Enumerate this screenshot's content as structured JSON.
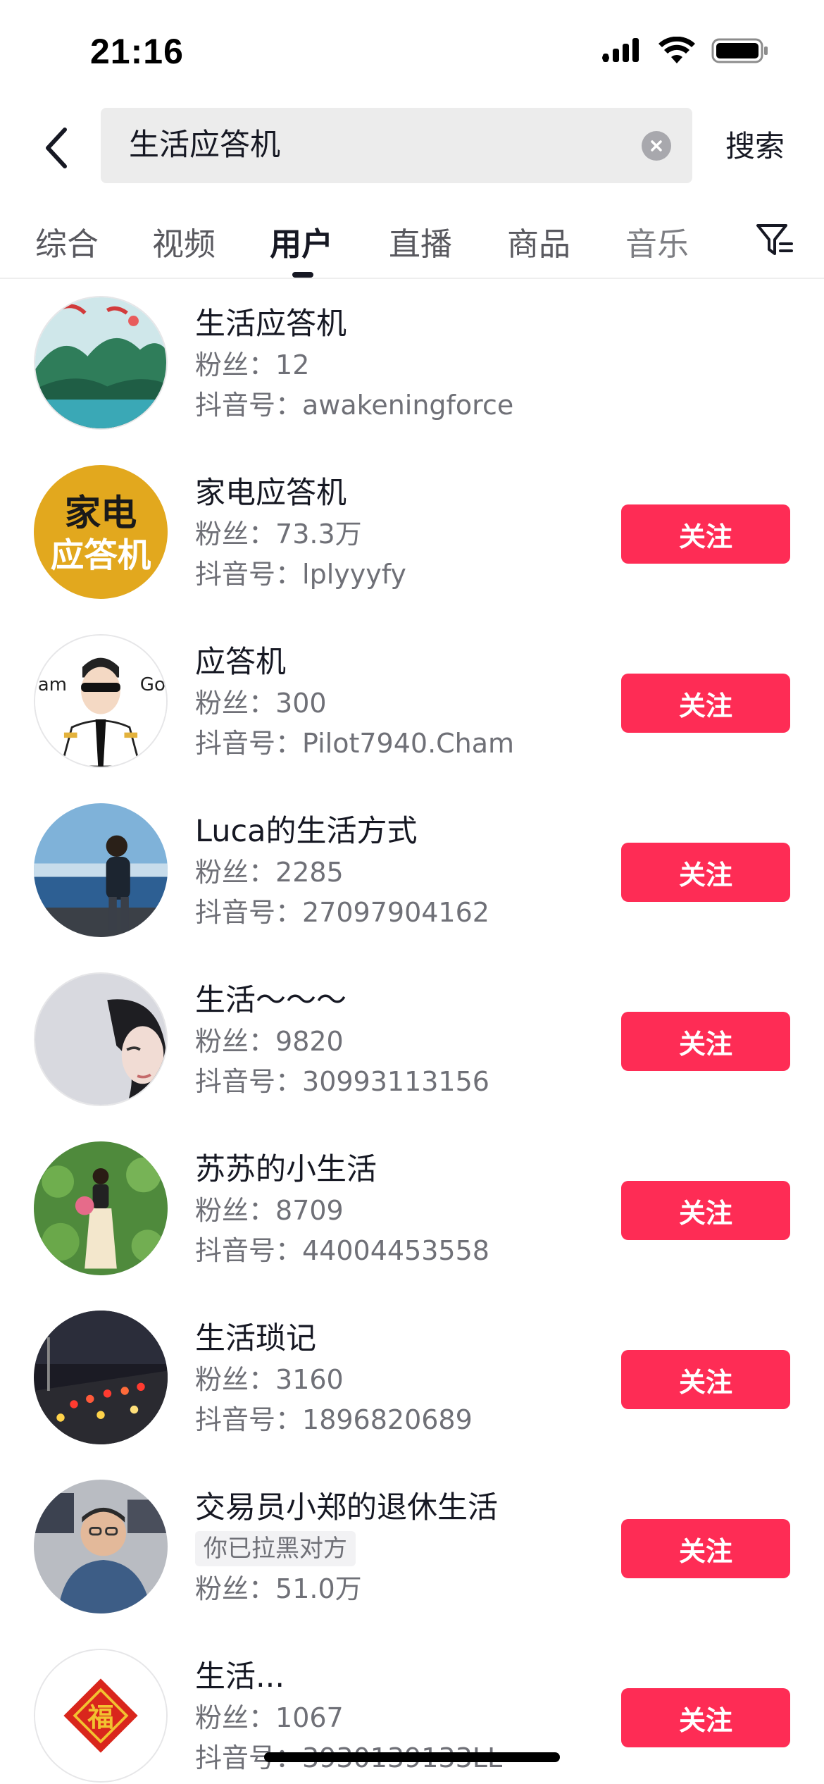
{
  "status_bar": {
    "time": "21:16"
  },
  "search": {
    "value": "生活应答机",
    "submit_label": "搜索"
  },
  "tabs": [
    {
      "label": "综合"
    },
    {
      "label": "视频"
    },
    {
      "label": "用户"
    },
    {
      "label": "直播"
    },
    {
      "label": "商品"
    },
    {
      "label": "音乐"
    }
  ],
  "active_tab": "用户",
  "labels": {
    "fans": "粉丝：",
    "douyin_id": "抖音号：",
    "follow": "关注"
  },
  "users": [
    {
      "name": "生活应答机",
      "fans": "12",
      "douyin_id": "awakeningforce",
      "avatar": "landscape-painting"
    },
    {
      "name": "家电应答机",
      "fans": "73.3万",
      "douyin_id": "lplyyyfy",
      "avatar": "text-logo",
      "avatar_text_1": "家电",
      "avatar_text_2": "应答机"
    },
    {
      "name": "应答机",
      "fans": "300",
      "douyin_id": "Pilot7940.Cham",
      "avatar": "pilot-cartoon",
      "avatar_text_1": "am",
      "avatar_text_2": "Go"
    },
    {
      "name": "Luca的生活方式",
      "fans": "2285",
      "douyin_id": "27097904162",
      "avatar": "beach-person"
    },
    {
      "name": "生活～～～",
      "fans": "9820",
      "douyin_id": "30993113156",
      "avatar": "girl-face"
    },
    {
      "name": "苏苏的小生活",
      "fans": "8709",
      "douyin_id": "44004453558",
      "avatar": "lotus-field"
    },
    {
      "name": "生活琐记",
      "fans": "3160",
      "douyin_id": "1896820689",
      "avatar": "night-traffic"
    },
    {
      "name": "交易员小郑的退休生活",
      "blocked_tag": "你已拉黑对方",
      "fans": "51.0万",
      "avatar": "man-office"
    },
    {
      "name": "生活...",
      "fans": "1067",
      "douyin_id": "3930139133LL",
      "avatar": "fu-diamond",
      "avatar_text_1": "福"
    }
  ],
  "colors": {
    "follow_button": "#fe2c55",
    "text_primary": "#161823",
    "text_secondary": "#6f7077"
  }
}
